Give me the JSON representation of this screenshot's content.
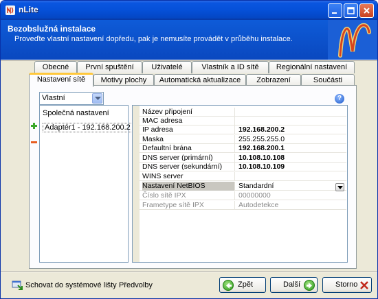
{
  "window": {
    "title": "nLite"
  },
  "header": {
    "title": "Bezobslužná instalace",
    "subtitle": "Proveďte vlastní nastavení dopředu, pak je nemusíte provádět v průběhu instalace."
  },
  "tabs_back": [
    "Obecné",
    "První spuštění",
    "Uživatelé",
    "Vlastník a ID sítě",
    "Regionální nastavení"
  ],
  "tabs_front": [
    "Nastavení sítě",
    "Motivy plochy",
    "Automatická aktualizace",
    "Zobrazení",
    "Součásti"
  ],
  "active_tab": "Nastavení sítě",
  "mode_select": {
    "value": "Vlastní"
  },
  "left_list": {
    "items": [
      "Společná nastavení",
      "Adaptér1 - 192.168.200.2"
    ]
  },
  "properties": [
    {
      "label": "Název připojení",
      "value": "",
      "bold": false
    },
    {
      "label": "MAC adresa",
      "value": "",
      "bold": false
    },
    {
      "label": "IP adresa",
      "value": "192.168.200.2",
      "bold": true
    },
    {
      "label": "Maska",
      "value": "255.255.255.0",
      "bold": false
    },
    {
      "label": "Defaultní brána",
      "value": "192.168.200.1",
      "bold": true
    },
    {
      "label": "DNS server (primární)",
      "value": "10.108.10.108",
      "bold": true
    },
    {
      "label": "DNS server (sekundární)",
      "value": "10.108.10.109",
      "bold": true
    },
    {
      "label": "WINS server",
      "value": "",
      "bold": false
    },
    {
      "label": "Nastavení NetBIOS",
      "value": "Standardní",
      "bold": false
    },
    {
      "label": "Číslo sítě IPX",
      "value": "00000000",
      "bold": false
    },
    {
      "label": "Frametype sítě IPX",
      "value": "Autodetekce",
      "bold": false
    }
  ],
  "footer": {
    "hide_tray": "Schovat do systémové lišty",
    "preferences": "Předvolby",
    "back": "Zpět",
    "next": "Další",
    "cancel": "Storno"
  },
  "colors": {
    "titlebar": "#0550d8",
    "header": "#0a48bf",
    "active_tab_accent": "#ffc83c"
  }
}
